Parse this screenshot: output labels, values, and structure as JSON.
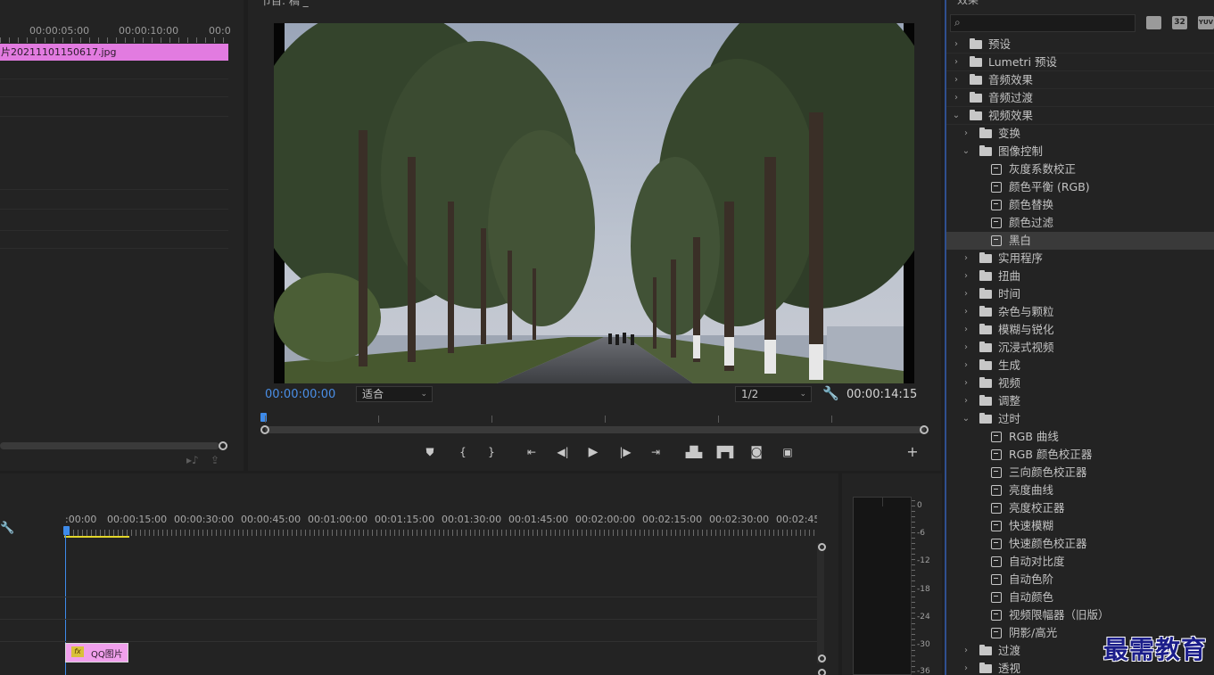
{
  "source": {
    "ruler": [
      "00:00:05:00",
      "00:00:10:00",
      "00:0"
    ],
    "clip_name": "片20211101150617.jpg"
  },
  "program": {
    "title": "节目: 稿 _",
    "current_time": "00:00:00:00",
    "fit_label": "适合",
    "resolution": "1/2",
    "duration": "00:00:14:15"
  },
  "timeline": {
    "ruler": [
      ":00:00",
      "00:00:15:00",
      "00:00:30:00",
      "00:00:45:00",
      "00:01:00:00",
      "00:01:15:00",
      "00:01:30:00",
      "00:01:45:00",
      "00:02:00:00",
      "00:02:15:00",
      "00:02:30:00",
      "00:02:45:"
    ],
    "clip_fx": "fx",
    "clip_name": "QQ图片"
  },
  "meter": {
    "scale": [
      "0",
      "-6",
      "-12",
      "-18",
      "-24",
      "-30",
      "-36"
    ]
  },
  "effects": {
    "title": "效果",
    "tree": [
      {
        "label": "预设",
        "level": 0,
        "kind": "folder",
        "expanded": false
      },
      {
        "label": "Lumetri 预设",
        "level": 0,
        "kind": "folder",
        "expanded": false
      },
      {
        "label": "音频效果",
        "level": 0,
        "kind": "folder",
        "expanded": false
      },
      {
        "label": "音频过渡",
        "level": 0,
        "kind": "folder",
        "expanded": false
      },
      {
        "label": "视频效果",
        "level": 0,
        "kind": "folder",
        "expanded": true
      },
      {
        "label": "变换",
        "level": 1,
        "kind": "folder",
        "expanded": false
      },
      {
        "label": "图像控制",
        "level": 1,
        "kind": "folder",
        "expanded": true
      },
      {
        "label": "灰度系数校正",
        "level": 2,
        "kind": "effect"
      },
      {
        "label": "颜色平衡 (RGB)",
        "level": 2,
        "kind": "effect"
      },
      {
        "label": "颜色替换",
        "level": 2,
        "kind": "effect"
      },
      {
        "label": "颜色过滤",
        "level": 2,
        "kind": "effect"
      },
      {
        "label": "黑白",
        "level": 2,
        "kind": "effect",
        "selected": true
      },
      {
        "label": "实用程序",
        "level": 1,
        "kind": "folder",
        "expanded": false
      },
      {
        "label": "扭曲",
        "level": 1,
        "kind": "folder",
        "expanded": false
      },
      {
        "label": "时间",
        "level": 1,
        "kind": "folder",
        "expanded": false
      },
      {
        "label": "杂色与颗粒",
        "level": 1,
        "kind": "folder",
        "expanded": false
      },
      {
        "label": "模糊与锐化",
        "level": 1,
        "kind": "folder",
        "expanded": false
      },
      {
        "label": "沉浸式视频",
        "level": 1,
        "kind": "folder",
        "expanded": false
      },
      {
        "label": "生成",
        "level": 1,
        "kind": "folder",
        "expanded": false
      },
      {
        "label": "视频",
        "level": 1,
        "kind": "folder",
        "expanded": false
      },
      {
        "label": "调整",
        "level": 1,
        "kind": "folder",
        "expanded": false
      },
      {
        "label": "过时",
        "level": 1,
        "kind": "folder",
        "expanded": true
      },
      {
        "label": "RGB 曲线",
        "level": 2,
        "kind": "effect"
      },
      {
        "label": "RGB 颜色校正器",
        "level": 2,
        "kind": "effect"
      },
      {
        "label": "三向颜色校正器",
        "level": 2,
        "kind": "effect"
      },
      {
        "label": "亮度曲线",
        "level": 2,
        "kind": "effect"
      },
      {
        "label": "亮度校正器",
        "level": 2,
        "kind": "effect"
      },
      {
        "label": "快速模糊",
        "level": 2,
        "kind": "effect"
      },
      {
        "label": "快速颜色校正器",
        "level": 2,
        "kind": "effect"
      },
      {
        "label": "自动对比度",
        "level": 2,
        "kind": "effect"
      },
      {
        "label": "自动色阶",
        "level": 2,
        "kind": "effect"
      },
      {
        "label": "自动颜色",
        "level": 2,
        "kind": "effect"
      },
      {
        "label": "视频限幅器（旧版）",
        "level": 2,
        "kind": "effect"
      },
      {
        "label": "阴影/高光",
        "level": 2,
        "kind": "effect"
      },
      {
        "label": "过渡",
        "level": 1,
        "kind": "folder",
        "expanded": false
      },
      {
        "label": "透视",
        "level": 1,
        "kind": "folder",
        "expanded": false
      }
    ],
    "badges": [
      "32",
      "YUV"
    ]
  },
  "watermark": "最需教育"
}
